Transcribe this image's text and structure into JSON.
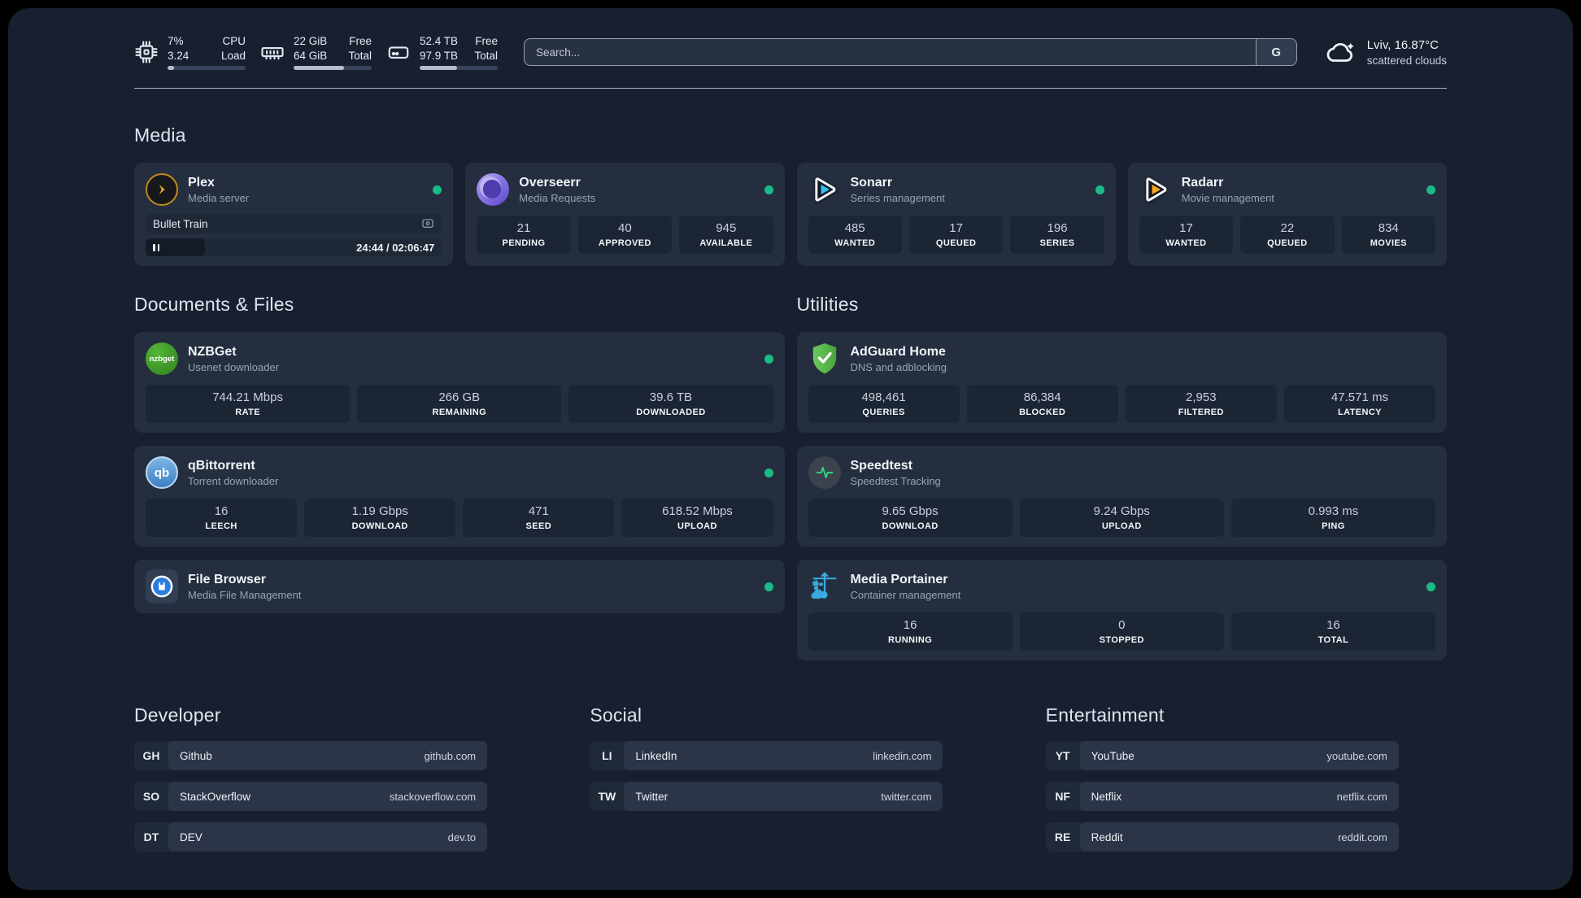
{
  "topbar": {
    "cpu": {
      "usage": "7%",
      "load": "3.24",
      "label_line1": "CPU",
      "label_line2": "Load",
      "progress_pct": 8
    },
    "ram": {
      "free": "22 GiB",
      "total": "64 GiB",
      "label_line1": "Free",
      "label_line2": "Total",
      "progress_pct": 65
    },
    "disk": {
      "free": "52.4 TB",
      "total": "97.9 TB",
      "label_line1": "Free",
      "label_line2": "Total",
      "progress_pct": 48
    },
    "search": {
      "placeholder": "Search...",
      "button_label": "G"
    },
    "weather": {
      "location_temp": "Lviv, 16.87°C",
      "condition": "scattered clouds"
    }
  },
  "colors": {
    "status_online": "#1abc85",
    "accent_plex": "#e5a00d",
    "accent_sonarr": "#33c0f0",
    "accent_radarr": "#f6a722"
  },
  "sections": {
    "media": "Media",
    "documents": "Documents & Files",
    "utilities": "Utilities",
    "developer": "Developer",
    "social": "Social",
    "entertainment": "Entertainment"
  },
  "apps": {
    "plex": {
      "name": "Plex",
      "description": "Media server",
      "now_playing": {
        "title": "Bullet Train",
        "time_display": "24:44 / 02:06:47",
        "progress_pct": 20
      }
    },
    "overseerr": {
      "name": "Overseerr",
      "description": "Media Requests",
      "stats": [
        {
          "value": "21",
          "label": "PENDING"
        },
        {
          "value": "40",
          "label": "APPROVED"
        },
        {
          "value": "945",
          "label": "AVAILABLE"
        }
      ]
    },
    "sonarr": {
      "name": "Sonarr",
      "description": "Series management",
      "stats": [
        {
          "value": "485",
          "label": "WANTED"
        },
        {
          "value": "17",
          "label": "QUEUED"
        },
        {
          "value": "196",
          "label": "SERIES"
        }
      ]
    },
    "radarr": {
      "name": "Radarr",
      "description": "Movie management",
      "stats": [
        {
          "value": "17",
          "label": "WANTED"
        },
        {
          "value": "22",
          "label": "QUEUED"
        },
        {
          "value": "834",
          "label": "MOVIES"
        }
      ]
    },
    "nzbget": {
      "name": "NZBGet",
      "description": "Usenet downloader",
      "icon_text": "nzbget",
      "stats": [
        {
          "value": "744.21 Mbps",
          "label": "RATE"
        },
        {
          "value": "266 GB",
          "label": "REMAINING"
        },
        {
          "value": "39.6 TB",
          "label": "DOWNLOADED"
        }
      ]
    },
    "qbittorrent": {
      "name": "qBittorrent",
      "description": "Torrent downloader",
      "icon_text": "qb",
      "stats": [
        {
          "value": "16",
          "label": "LEECH"
        },
        {
          "value": "1.19 Gbps",
          "label": "DOWNLOAD"
        },
        {
          "value": "471",
          "label": "SEED"
        },
        {
          "value": "618.52 Mbps",
          "label": "UPLOAD"
        }
      ]
    },
    "filebrowser": {
      "name": "File Browser",
      "description": "Media File Management"
    },
    "adguard": {
      "name": "AdGuard Home",
      "description": "DNS and adblocking",
      "stats": [
        {
          "value": "498,461",
          "label": "QUERIES"
        },
        {
          "value": "86,384",
          "label": "BLOCKED"
        },
        {
          "value": "2,953",
          "label": "FILTERED"
        },
        {
          "value": "47.571 ms",
          "label": "LATENCY"
        }
      ]
    },
    "speedtest": {
      "name": "Speedtest",
      "description": "Speedtest Tracking",
      "stats": [
        {
          "value": "9.65 Gbps",
          "label": "DOWNLOAD"
        },
        {
          "value": "9.24 Gbps",
          "label": "UPLOAD"
        },
        {
          "value": "0.993 ms",
          "label": "PING"
        }
      ]
    },
    "portainer": {
      "name": "Media Portainer",
      "description": "Container management",
      "stats": [
        {
          "value": "16",
          "label": "RUNNING"
        },
        {
          "value": "0",
          "label": "STOPPED"
        },
        {
          "value": "16",
          "label": "TOTAL"
        }
      ]
    }
  },
  "bookmarks": {
    "developer": [
      {
        "abbr": "GH",
        "name": "Github",
        "url": "github.com"
      },
      {
        "abbr": "SO",
        "name": "StackOverflow",
        "url": "stackoverflow.com"
      },
      {
        "abbr": "DT",
        "name": "DEV",
        "url": "dev.to"
      }
    ],
    "social": [
      {
        "abbr": "LI",
        "name": "LinkedIn",
        "url": "linkedin.com"
      },
      {
        "abbr": "TW",
        "name": "Twitter",
        "url": "twitter.com"
      }
    ],
    "entertainment": [
      {
        "abbr": "YT",
        "name": "YouTube",
        "url": "youtube.com"
      },
      {
        "abbr": "NF",
        "name": "Netflix",
        "url": "netflix.com"
      },
      {
        "abbr": "RE",
        "name": "Reddit",
        "url": "reddit.com"
      }
    ]
  }
}
